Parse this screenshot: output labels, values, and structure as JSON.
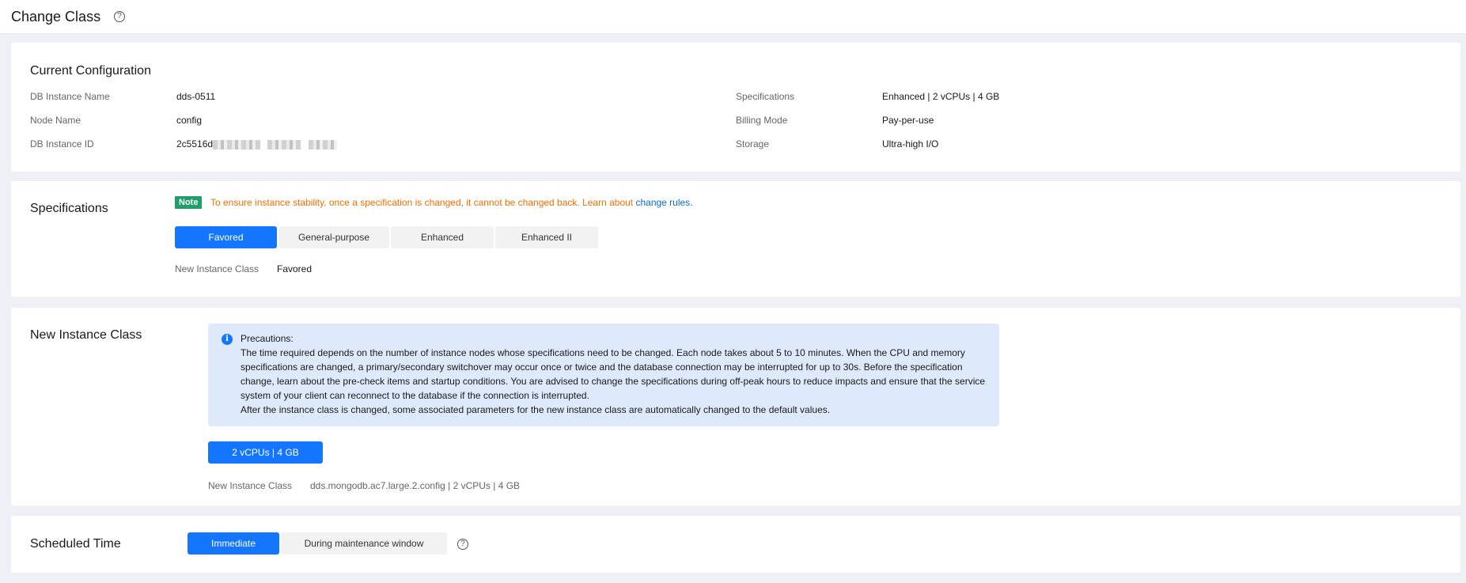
{
  "header": {
    "title": "Change Class"
  },
  "current": {
    "title": "Current Configuration",
    "left": [
      {
        "label": "DB Instance Name",
        "value": "dds-0511"
      },
      {
        "label": "Node Name",
        "value": "config"
      },
      {
        "label": "DB Instance ID",
        "value": "2c5516d"
      }
    ],
    "right": [
      {
        "label": "Specifications",
        "value": "Enhanced | 2 vCPUs | 4 GB"
      },
      {
        "label": "Billing Mode",
        "value": "Pay-per-use"
      },
      {
        "label": "Storage",
        "value": "Ultra-high I/O"
      }
    ]
  },
  "specs": {
    "title": "Specifications",
    "note_tag": "Note",
    "note_text": "To ensure instance stability, once a specification is changed, it cannot be changed back. Learn about ",
    "note_link": "change rules",
    "note_end": ".",
    "tabs": [
      "Favored",
      "General-purpose",
      "Enhanced",
      "Enhanced II"
    ],
    "new_class_label": "New Instance Class",
    "new_class_value": "Favored"
  },
  "newclass": {
    "title": "New Instance Class",
    "precautions_title": "Precautions:",
    "line1": "The time required depends on the number of instance nodes whose specifications need to be changed. Each node takes about 5 to 10 minutes. When the CPU and memory",
    "line2": "specifications are changed, a primary/secondary switchover may occur once or twice and the database connection may be interrupted for up to 30s. Before the specification",
    "line3": "change, learn about the pre-check items and startup conditions. You are advised to change the specifications during off-peak hours to reduce impacts and ensure that the service",
    "line4": "system of your client can reconnect to the database if the connection is interrupted.",
    "line5": "After the instance class is changed, some associated parameters for the new instance class are automatically changed to the default values.",
    "option": "2 vCPUs | 4 GB",
    "label": "New Instance Class",
    "value": "dds.mongodb.ac7.large.2.config | 2 vCPUs | 4 GB"
  },
  "schedule": {
    "title": "Scheduled Time",
    "options": [
      "Immediate",
      "During maintenance window"
    ]
  }
}
